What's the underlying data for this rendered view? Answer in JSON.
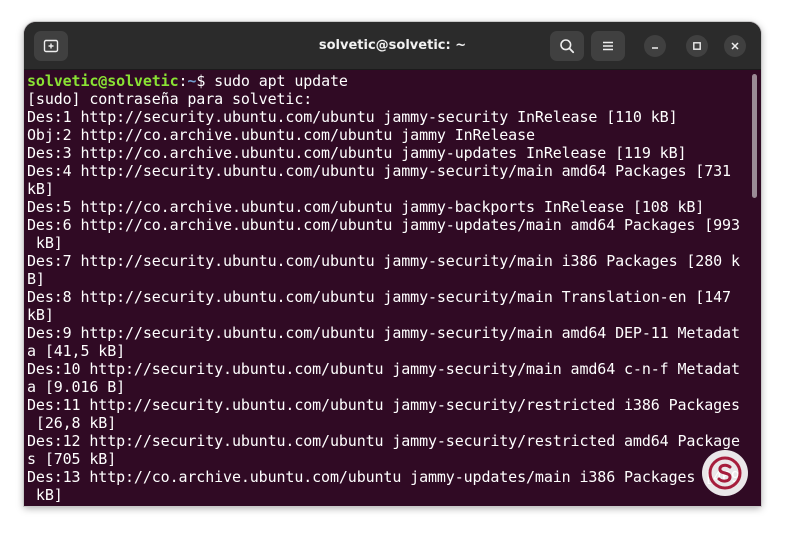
{
  "window": {
    "title": "solvetic@solvetic: ~"
  },
  "icons": {
    "new_tab": "new-tab-icon",
    "search": "search-icon",
    "menu": "hamburger-menu-icon",
    "minimize": "minimize-icon",
    "maximize": "maximize-icon",
    "close": "close-icon",
    "watermark": "solvetic-logo-icon"
  },
  "colors": {
    "terminal_bg": "#300a24",
    "prompt_user": "#8ae234",
    "prompt_path": "#729fcf",
    "text": "#ffffff",
    "titlebar_bg": "#2b2b2b"
  },
  "terminal": {
    "prompt": {
      "user_host": "solvetic@solvetic",
      "separator": ":",
      "path": "~",
      "symbol": "$",
      "command": " sudo apt update"
    },
    "lines": [
      "[sudo] contraseña para solvetic:",
      "Des:1 http://security.ubuntu.com/ubuntu jammy-security InRelease [110 kB]",
      "Obj:2 http://co.archive.ubuntu.com/ubuntu jammy InRelease",
      "Des:3 http://co.archive.ubuntu.com/ubuntu jammy-updates InRelease [119 kB]",
      "Des:4 http://security.ubuntu.com/ubuntu jammy-security/main amd64 Packages [731",
      "kB]",
      "Des:5 http://co.archive.ubuntu.com/ubuntu jammy-backports InRelease [108 kB]",
      "Des:6 http://co.archive.ubuntu.com/ubuntu jammy-updates/main amd64 Packages [993",
      " kB]",
      "Des:7 http://security.ubuntu.com/ubuntu jammy-security/main i386 Packages [280 k",
      "B]",
      "Des:8 http://security.ubuntu.com/ubuntu jammy-security/main Translation-en [147",
      "kB]",
      "Des:9 http://security.ubuntu.com/ubuntu jammy-security/main amd64 DEP-11 Metadat",
      "a [41,5 kB]",
      "Des:10 http://security.ubuntu.com/ubuntu jammy-security/main amd64 c-n-f Metadat",
      "a [9.016 B]",
      "Des:11 http://security.ubuntu.com/ubuntu jammy-security/restricted i386 Packages",
      " [26,8 kB]",
      "Des:12 http://security.ubuntu.com/ubuntu jammy-security/restricted amd64 Package",
      "s [705 kB]",
      "Des:13 http://co.archive.ubuntu.com/ubuntu jammy-updates/main i386 Packages [469",
      " kB]"
    ]
  }
}
